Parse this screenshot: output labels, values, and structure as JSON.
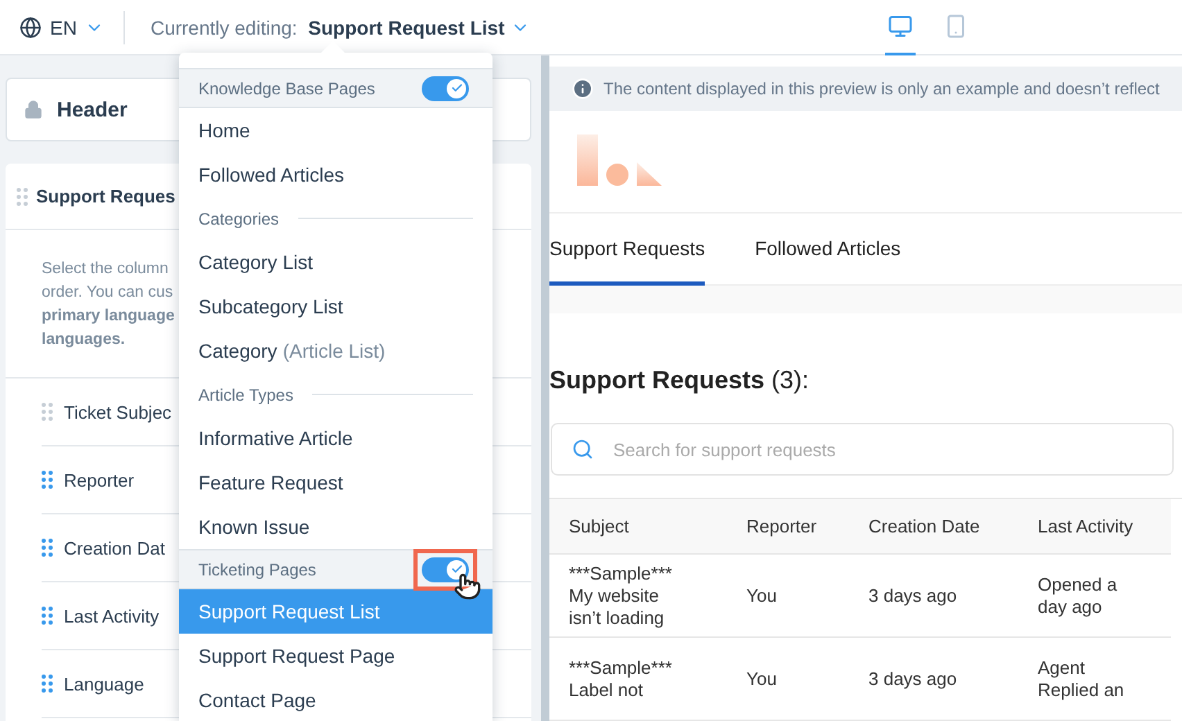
{
  "top_bar": {
    "language": "EN",
    "editing_label": "Currently editing:",
    "editing_page": "Support Request List",
    "devices": [
      {
        "kind": "desktop",
        "selected": true
      },
      {
        "kind": "mobile",
        "selected": false
      }
    ]
  },
  "left_panel": {
    "header_card": {
      "title": "Header",
      "locked": true
    },
    "section_card": {
      "title": "Support Reques",
      "description": [
        "Select the column",
        "order. You can cus",
        "**primary language**",
        "**languages.**"
      ],
      "columns": [
        {
          "label": "Ticket Subjec",
          "draggable": false
        },
        {
          "label": "Reporter",
          "draggable": true
        },
        {
          "label": "Creation Dat",
          "draggable": true
        },
        {
          "label": "Last Activity",
          "draggable": true
        },
        {
          "label": "Language",
          "draggable": true
        }
      ]
    }
  },
  "page_menu": {
    "groups": [
      {
        "kind": "section",
        "title": "Knowledge Base Pages",
        "on": true,
        "highlighted": false,
        "items": [
          {
            "label": "Home",
            "selected": false
          },
          {
            "label": "Followed Articles",
            "selected": false
          }
        ]
      },
      {
        "kind": "subheading",
        "title": "Categories",
        "items": [
          {
            "label": "Category List",
            "selected": false
          },
          {
            "label": "Subcategory List",
            "selected": false
          },
          {
            "label": "Category",
            "note": "(Article List)",
            "selected": false
          }
        ]
      },
      {
        "kind": "subheading",
        "title": "Article Types",
        "items": [
          {
            "label": "Informative Article",
            "selected": false
          },
          {
            "label": "Feature Request",
            "selected": false
          },
          {
            "label": "Known Issue",
            "selected": false
          }
        ]
      },
      {
        "kind": "section",
        "title": "Ticketing Pages",
        "on": true,
        "highlighted": true,
        "items": [
          {
            "label": "Support Request List",
            "selected": true
          },
          {
            "label": "Support Request Page",
            "selected": false
          },
          {
            "label": "Contact Page",
            "selected": false
          }
        ]
      }
    ]
  },
  "preview": {
    "notice": "The content displayed in this preview is only an example and doesn’t reflect",
    "tabs": [
      {
        "label": "Support Requests",
        "selected": true
      },
      {
        "label": "Followed Articles",
        "selected": false
      }
    ],
    "heading": "Support Requests",
    "count": "(3):",
    "search": {
      "placeholder": "Search for support requests"
    },
    "table": {
      "columns": [
        "Subject",
        "Reporter",
        "Creation Date",
        "Last Activity"
      ],
      "rows": [
        [
          "***Sample***\nMy website\nisn’t loading",
          "You",
          "3 days ago",
          "Opened a\nday ago"
        ],
        [
          "***Sample***\nLabel not",
          "You",
          "3 days ago",
          "Agent\nReplied an"
        ]
      ]
    }
  }
}
